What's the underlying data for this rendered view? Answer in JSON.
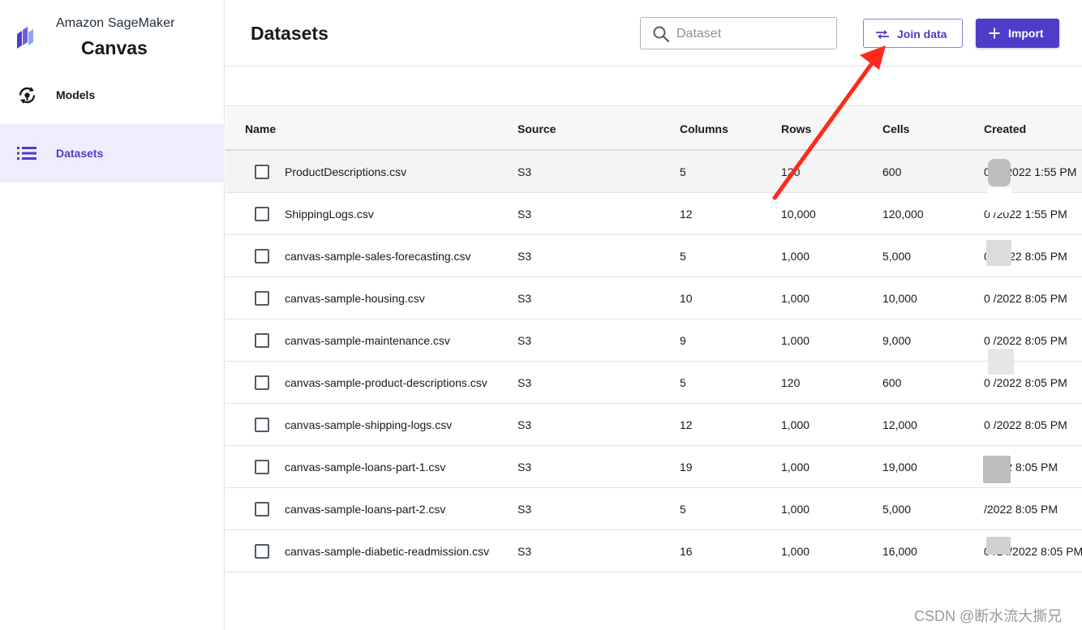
{
  "app": {
    "brand_sub": "Amazon SageMaker",
    "brand_title": "Canvas",
    "brand_color": "#4f3cc9"
  },
  "sidebar": {
    "items": [
      {
        "label": "Models",
        "icon": "models-refresh-icon",
        "active": false
      },
      {
        "label": "Datasets",
        "icon": "list-icon",
        "active": true
      }
    ]
  },
  "header": {
    "title": "Datasets",
    "search": {
      "placeholder": "Dataset",
      "value": ""
    },
    "join_label": "Join data",
    "import_label": "Import"
  },
  "table": {
    "columns": [
      "Name",
      "Source",
      "Columns",
      "Rows",
      "Cells",
      "Created"
    ],
    "rows": [
      {
        "name": "ProductDescriptions.csv",
        "source": "S3",
        "columns": "5",
        "rows": "120",
        "cells": "600",
        "created": "0 /5/2022 1:55 PM"
      },
      {
        "name": "ShippingLogs.csv",
        "source": "S3",
        "columns": "12",
        "rows": "10,000",
        "cells": "120,000",
        "created": "0 /2022 1:55 PM"
      },
      {
        "name": "canvas-sample-sales-forecasting.csv",
        "source": "S3",
        "columns": "5",
        "rows": "1,000",
        "cells": "5,000",
        "created": "0 /2022 8:05 PM"
      },
      {
        "name": "canvas-sample-housing.csv",
        "source": "S3",
        "columns": "10",
        "rows": "1,000",
        "cells": "10,000",
        "created": "0 /2022 8:05 PM"
      },
      {
        "name": "canvas-sample-maintenance.csv",
        "source": "S3",
        "columns": "9",
        "rows": "1,000",
        "cells": "9,000",
        "created": "0 /2022 8:05 PM"
      },
      {
        "name": "canvas-sample-product-descriptions.csv",
        "source": "S3",
        "columns": "5",
        "rows": "120",
        "cells": "600",
        "created": "0 /2022 8:05 PM"
      },
      {
        "name": "canvas-sample-shipping-logs.csv",
        "source": "S3",
        "columns": "12",
        "rows": "1,000",
        "cells": "12,000",
        "created": "0 /2022 8:05 PM"
      },
      {
        "name": "canvas-sample-loans-part-1.csv",
        "source": "S3",
        "columns": "19",
        "rows": "1,000",
        "cells": "19,000",
        "created": "/2022 8:05 PM"
      },
      {
        "name": "canvas-sample-loans-part-2.csv",
        "source": "S3",
        "columns": "5",
        "rows": "1,000",
        "cells": "5,000",
        "created": "/2022 8:05 PM"
      },
      {
        "name": "canvas-sample-diabetic-readmission.csv",
        "source": "S3",
        "columns": "16",
        "rows": "1,000",
        "cells": "16,000",
        "created": "0 /14/2022 8:05 PM"
      }
    ]
  },
  "watermark": "CSDN @断水流大撕兄",
  "annotation_color": "#ff2a1a"
}
